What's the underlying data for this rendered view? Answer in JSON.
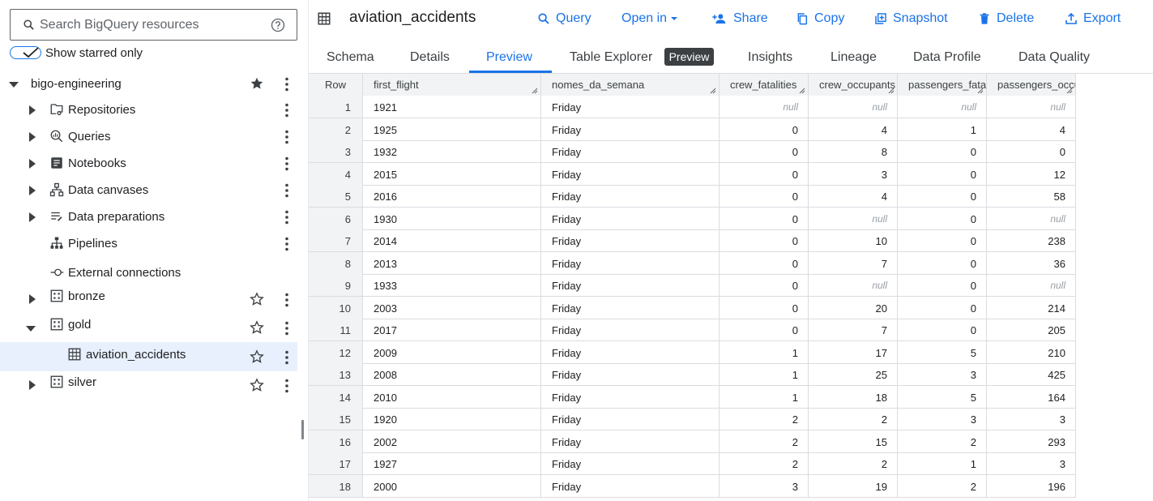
{
  "explorer": {
    "search_placeholder": "Search BigQuery resources",
    "starred_label": "Show starred only",
    "project": "bigo-engineering",
    "items": [
      {
        "label": "Repositories",
        "icon": "repository-icon"
      },
      {
        "label": "Queries",
        "icon": "query-icon"
      },
      {
        "label": "Notebooks",
        "icon": "notebook-icon"
      },
      {
        "label": "Data canvases",
        "icon": "data-canvas-icon"
      },
      {
        "label": "Data preparations",
        "icon": "data-preparation-icon"
      },
      {
        "label": "Pipelines",
        "icon": "pipeline-icon"
      },
      {
        "label": "External connections",
        "icon": "connection-icon"
      }
    ],
    "datasets": [
      {
        "label": "bronze",
        "expanded": false
      },
      {
        "label": "gold",
        "expanded": true,
        "tables": [
          "aviation_accidents"
        ]
      },
      {
        "label": "silver",
        "expanded": false
      }
    ]
  },
  "header": {
    "title": "aviation_accidents",
    "actions": {
      "query": "Query",
      "open_in": "Open in",
      "share": "Share",
      "copy": "Copy",
      "snapshot": "Snapshot",
      "delete": "Delete",
      "export": "Export"
    }
  },
  "tabs": {
    "schema": "Schema",
    "details": "Details",
    "preview": "Preview",
    "table_explorer": "Table Explorer",
    "table_explorer_badge": "Preview",
    "insights": "Insights",
    "lineage": "Lineage",
    "data_profile": "Data Profile",
    "data_quality": "Data Quality",
    "active": "Preview"
  },
  "grid": {
    "columns": [
      "Row",
      "first_flight",
      "nomes_da_semana",
      "crew_fatalities",
      "crew_occupants",
      "passengers_fatalities",
      "passengers_occupants"
    ],
    "rows": [
      [
        "1",
        "1921",
        "Friday",
        "null",
        "null",
        "null",
        "null"
      ],
      [
        "2",
        "1925",
        "Friday",
        "0",
        "4",
        "1",
        "4"
      ],
      [
        "3",
        "1932",
        "Friday",
        "0",
        "8",
        "0",
        "0"
      ],
      [
        "4",
        "2015",
        "Friday",
        "0",
        "3",
        "0",
        "12"
      ],
      [
        "5",
        "2016",
        "Friday",
        "0",
        "4",
        "0",
        "58"
      ],
      [
        "6",
        "1930",
        "Friday",
        "0",
        "null",
        "0",
        "null"
      ],
      [
        "7",
        "2014",
        "Friday",
        "0",
        "10",
        "0",
        "238"
      ],
      [
        "8",
        "2013",
        "Friday",
        "0",
        "7",
        "0",
        "36"
      ],
      [
        "9",
        "1933",
        "Friday",
        "0",
        "null",
        "0",
        "null"
      ],
      [
        "10",
        "2003",
        "Friday",
        "0",
        "20",
        "0",
        "214"
      ],
      [
        "11",
        "2017",
        "Friday",
        "0",
        "7",
        "0",
        "205"
      ],
      [
        "12",
        "2009",
        "Friday",
        "1",
        "17",
        "5",
        "210"
      ],
      [
        "13",
        "2008",
        "Friday",
        "1",
        "25",
        "3",
        "425"
      ],
      [
        "14",
        "2010",
        "Friday",
        "1",
        "18",
        "5",
        "164"
      ],
      [
        "15",
        "1920",
        "Friday",
        "2",
        "2",
        "3",
        "3"
      ],
      [
        "16",
        "2002",
        "Friday",
        "2",
        "15",
        "2",
        "293"
      ],
      [
        "17",
        "1927",
        "Friday",
        "2",
        "2",
        "1",
        "3"
      ],
      [
        "18",
        "2000",
        "Friday",
        "3",
        "19",
        "2",
        "196"
      ]
    ]
  },
  "colors": {
    "accent": "#1a73e8",
    "selected_row": "#e8f0fe",
    "header_bg": "#f1f3f4",
    "null_text": "#9aa0a6"
  }
}
